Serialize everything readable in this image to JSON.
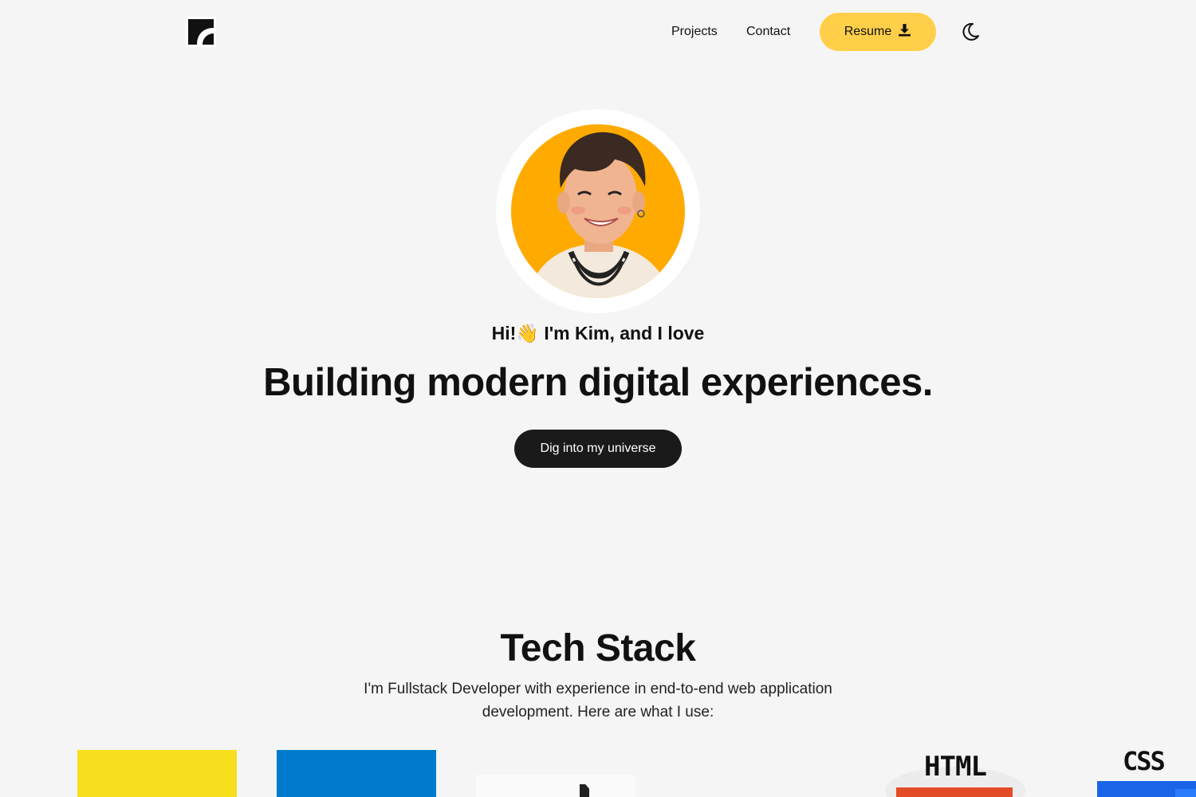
{
  "colors": {
    "accent": "#ffcf4a",
    "dark_button": "#1a1a1a",
    "background": "#f5f5f5",
    "avatar_bg": "#ffaa00"
  },
  "header": {
    "logo_icon": "logo-icon",
    "nav": [
      {
        "label": "Projects"
      },
      {
        "label": "Contact"
      }
    ],
    "resume_label": "Resume",
    "resume_icon": "download-icon",
    "theme_toggle_icon": "moon-icon"
  },
  "hero": {
    "greeting": "Hi!👋 I'm Kim, and I love",
    "headline": "Building modern digital experiences.",
    "cta_label": "Dig into my universe"
  },
  "tech_stack": {
    "title": "Tech Stack",
    "description": "I'm Fullstack Developer with experience in end-to-end web application development. Here are what I use:",
    "items": [
      {
        "icon": "javascript-icon",
        "color": "#f7df1e"
      },
      {
        "icon": "typescript-icon",
        "color": "#007acc"
      },
      {
        "icon": "nextjs-icon",
        "color": "#fafafa"
      },
      {
        "icon": "html-icon",
        "label": "HTML",
        "color": "#e34c26"
      },
      {
        "icon": "css-icon",
        "label": "CSS",
        "color": "#1a64e8"
      }
    ]
  }
}
